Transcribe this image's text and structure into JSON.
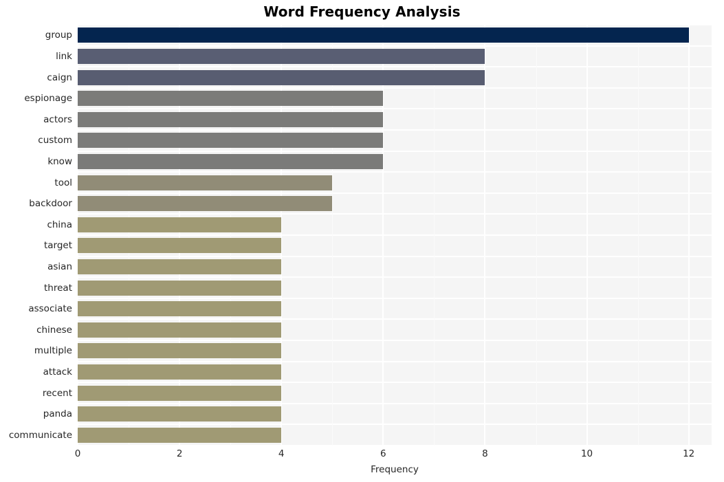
{
  "chart_data": {
    "type": "bar",
    "orientation": "horizontal",
    "title": "Word Frequency Analysis",
    "xlabel": "Frequency",
    "ylabel": "",
    "xlim": [
      0,
      12.45
    ],
    "xticks": [
      0,
      2,
      4,
      6,
      8,
      10,
      12
    ],
    "xticklabels": [
      "0",
      "2",
      "4",
      "6",
      "8",
      "10",
      "12"
    ],
    "grid": true,
    "legend": false,
    "categories": [
      "group",
      "link",
      "caign",
      "espionage",
      "actors",
      "custom",
      "know",
      "tool",
      "backdoor",
      "china",
      "target",
      "asian",
      "threat",
      "associate",
      "chinese",
      "multiple",
      "attack",
      "recent",
      "panda",
      "communicate"
    ],
    "values": [
      12,
      8,
      8,
      6,
      6,
      6,
      6,
      5,
      5,
      4,
      4,
      4,
      4,
      4,
      4,
      4,
      4,
      4,
      4,
      4
    ],
    "bar_colors": [
      "#04254f",
      "#595e73",
      "#585d71",
      "#7b7b79",
      "#7b7b79",
      "#7b7b79",
      "#7b7b79",
      "#918c77",
      "#918c77",
      "#a09a74",
      "#a09a74",
      "#a09a74",
      "#a09a74",
      "#a09a74",
      "#a09a74",
      "#a09a74",
      "#a09a74",
      "#a09a74",
      "#a09a74",
      "#a09a74"
    ],
    "plot_background": "#f5f5f5",
    "figure_background": "#ffffff",
    "gridline_color": "#ffffff",
    "tick_label_color": "#262626"
  }
}
